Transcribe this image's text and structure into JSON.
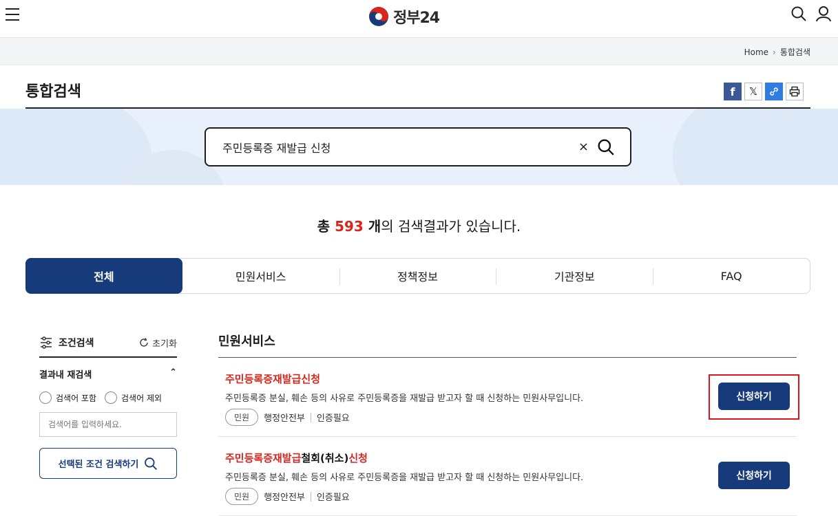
{
  "header": {
    "logo_text": "정부24"
  },
  "breadcrumb": {
    "home": "Home",
    "current": "통합검색"
  },
  "page": {
    "title": "통합검색"
  },
  "search": {
    "value": "주민등록증 재발급 신청",
    "clear_label": "×"
  },
  "result": {
    "prefix": "총 ",
    "count": "593",
    "unit": " 개",
    "suffix": "의 검색결과가 있습니다."
  },
  "tabs": [
    {
      "label": "전체",
      "active": true
    },
    {
      "label": "민원서비스"
    },
    {
      "label": "정책정보"
    },
    {
      "label": "기관정보"
    },
    {
      "label": "FAQ"
    }
  ],
  "sidebar": {
    "title": "조건검색",
    "reset_label": "초기화",
    "sub_title": "결과내 재검색",
    "include_label": "검색어 포함",
    "exclude_label": "검색어 제외",
    "input_placeholder": "검색어를 입력하세요.",
    "search_button_label": "선택된 조건 검색하기"
  },
  "main": {
    "section_title": "민원서비스",
    "items": [
      {
        "title_hl": "주민등록증재발급신청",
        "title_mid": "",
        "title_end": "",
        "desc": "주민등록증 분실, 훼손 등의 사유로 주민등록증을 재발급 받고자 할 때 신청하는 민원사무입니다.",
        "badge": "민원",
        "org": "행정안전부",
        "auth": "인증필요",
        "button": "신청하기"
      },
      {
        "title_hl": "주민등록증재발급",
        "title_mid": "철회(취소)",
        "title_end": "신청",
        "desc": "주민등록증 분실, 훼손 등의 사유로 주민등록증을 재발급 받고자 할 때 신청하는 민원사무입니다.",
        "badge": "민원",
        "org": "행정안전부",
        "auth": "인증필요",
        "button": "신청하기"
      }
    ]
  },
  "colors": {
    "primary": "#173b7a",
    "highlight": "#d9261c",
    "hero_bg": "#e8f1fb"
  }
}
